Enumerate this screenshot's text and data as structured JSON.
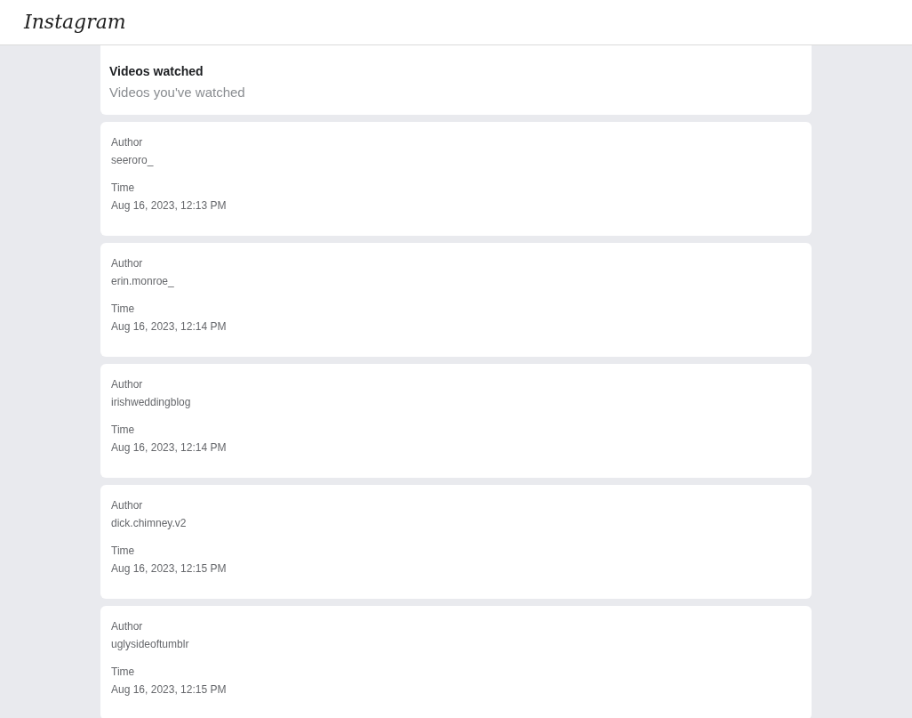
{
  "header": {
    "logo": "Instagram"
  },
  "section": {
    "title": "Videos watched",
    "subtitle": "Videos you've watched"
  },
  "entries": [
    {
      "fields": [
        {
          "label": "Author",
          "value": "seeroro_"
        },
        {
          "label": "Time",
          "value": "Aug 16, 2023, 12:13 PM"
        }
      ]
    },
    {
      "fields": [
        {
          "label": "Author",
          "value": "erin.monroe_"
        },
        {
          "label": "Time",
          "value": "Aug 16, 2023, 12:14 PM"
        }
      ]
    },
    {
      "fields": [
        {
          "label": "Author",
          "value": "irishweddingblog"
        },
        {
          "label": "Time",
          "value": "Aug 16, 2023, 12:14 PM"
        }
      ]
    },
    {
      "fields": [
        {
          "label": "Author",
          "value": "dick.chimney.v2"
        },
        {
          "label": "Time",
          "value": "Aug 16, 2023, 12:15 PM"
        }
      ]
    },
    {
      "fields": [
        {
          "label": "Author",
          "value": "uglysideoftumblr"
        },
        {
          "label": "Time",
          "value": "Aug 16, 2023, 12:15 PM"
        }
      ]
    }
  ]
}
